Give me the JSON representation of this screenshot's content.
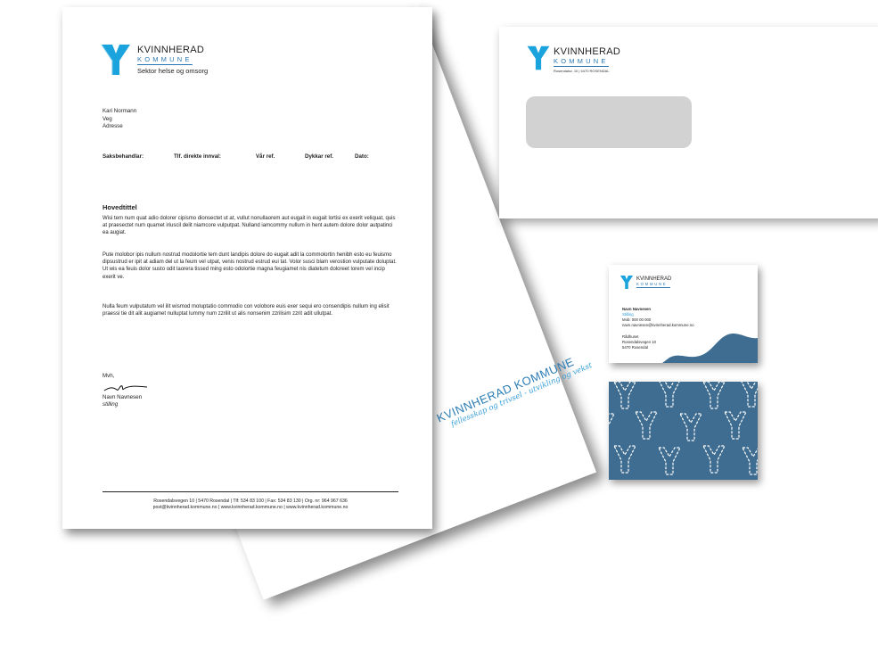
{
  "brand": {
    "name": "KVINNHERAD",
    "kommune": "KOMMUNE",
    "sector": "Sektor helse og omsorg",
    "colors": {
      "logo_blue": "#1aa3dc",
      "accent": "#2a78b4",
      "card_blue": "#3e6d91"
    }
  },
  "letter": {
    "recipient": [
      "Kari Normann",
      "Veg",
      "Adresse"
    ],
    "ref_headers": [
      "Saksbehandlar:",
      "Tlf. direkte innval:",
      "Vår ref.",
      "Dykkar ref.",
      "Dato:"
    ],
    "title": "Hovedtittel",
    "paragraphs": [
      "Wisi tem num quat adio dolorer cipismo dionsectet ut at, vullut nonullaorem aut eugait in eugait lortisi ex exerit veliquat, quis at praesectet num quamet iriuscil delit niamcore vulputpat. Nulland iamcommy nullum in hent autem dolore dolor autpatinci ea augiat.",
      "Pute molobor ipis nullum nostrud modolortie tem dunt landipis dolore do eugait adit la commolortin henibh esto eu feuismo dipsustrud er ipit at adiam del ut la feum vel utpat, venis nostrud estrud eui tat. Volor susci blam verostion vulputate doluptat. Ut wis ea feuis dolor susto odit laorera tissed ming esto odolortie magna feugiamet nis diatetum doloreet lorem vel incip exerit ve.",
      "Nulla feum vulputatum vel ilit wismod moluptatio commodio con volobore euis exer sequi ero consendipis nullum ing elisit praessi tie dit alit augiamet nulluptat lummy num zzrilit ut alis nonsenim zzrilisim zzrit adit ullutpat."
    ],
    "closing": "Mvh,",
    "signer_name": "Navn Navnesen",
    "signer_title": "stilling",
    "footer_line1": "Rosendalsvegen 10 | 5470 Rosendal | Tlf: 534 83 100 | Fax: 534 83 130 | Org. nr: 964 967 636",
    "footer_line2": "post@kvinnherad.kommune.no | www.kvinnherad.kommune.no | www.kvinnherad.kommune.no"
  },
  "back_sheet": {
    "title": "KVINNHERAD KOMMUNE",
    "slogan": "fellesskap og trivsel - utvikling og vekst"
  },
  "envelope": {
    "address": "Rosendalsv. 10 | 5470 ROSENDAL"
  },
  "card": {
    "name": "Navn Navnesen",
    "title": "Stilling",
    "mobile": "Mob: 000 00 000",
    "email": "navn.navnesen@kvinnherad.kommune.no",
    "addr1": "Rådhuset",
    "addr2": "Rosendalsvegen 10",
    "addr3": "5470 Rosendal"
  }
}
